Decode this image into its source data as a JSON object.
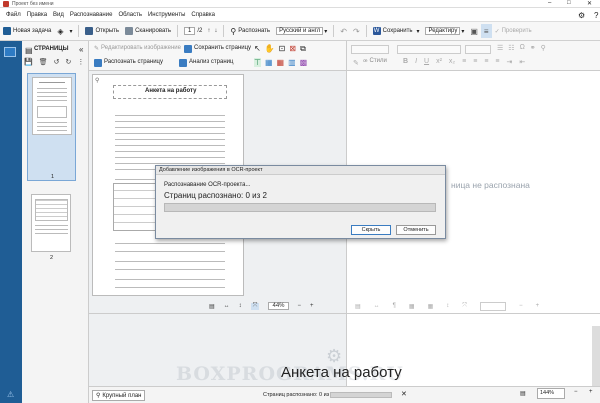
{
  "app": {
    "title": "Проект без имени"
  },
  "menu": [
    "Файл",
    "Правка",
    "Вид",
    "Распознавание",
    "Область",
    "Инструменты",
    "Справка"
  ],
  "toolbar": {
    "new_task": "Новая задача",
    "open": "Открыть",
    "scan": "Сканировать",
    "page_current": "1",
    "page_total": "/2",
    "recognize": "Распознать",
    "language": "Русский и англ",
    "save": "Сохранить",
    "edit_mode": "Редактиру",
    "check": "Проверить"
  },
  "pages_panel": {
    "title": "СТРАНИЦЫ",
    "thumb1_label": "1",
    "thumb2_label": "2"
  },
  "image_panel": {
    "edit_image": "Редактировать изображение",
    "save_page": "Сохранить страницу",
    "recognize_page": "Распознать страницу",
    "analyze_page": "Анализ страниц",
    "doc_heading": "Анкета на работу",
    "zoom": "44%"
  },
  "text_panel": {
    "styles": "Стили",
    "not_recognized": "ница не распознана"
  },
  "dialog": {
    "title": "Добавление изображения в OCR-проект",
    "status": "Распознавание OCR-проекта...",
    "progress_text": "Страниц распознано: 0 из 2",
    "progress": 0,
    "hide_button": "Скрыть",
    "cancel_button": "Отменить"
  },
  "status": {
    "zoom_button": "Крупный план",
    "recognized": "Страниц распознано: 0 из 2",
    "zoom": "144%"
  },
  "watermark": {
    "main": "Анкета на работу"
  },
  "colors": {
    "accent": "#1f5d95",
    "brand_red": "#c0392b",
    "word_blue": "#2b579a"
  }
}
